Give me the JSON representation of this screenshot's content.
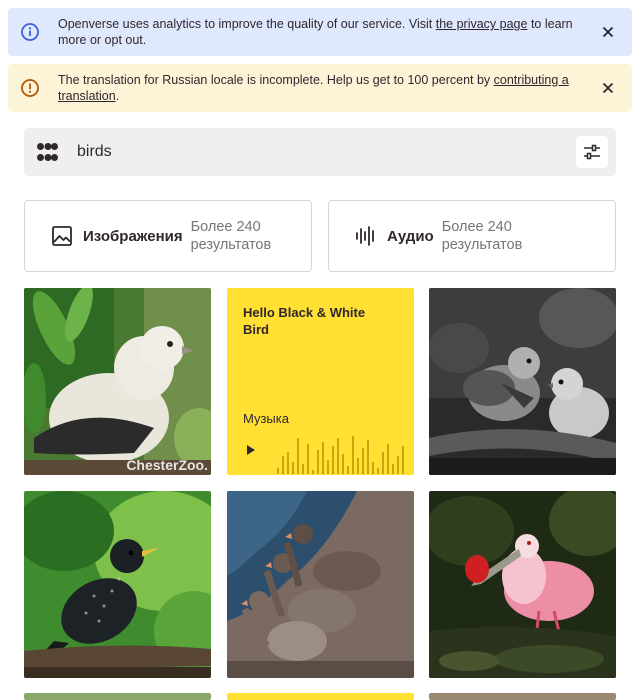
{
  "banners": {
    "analytics": {
      "text_before": "Openverse uses analytics to improve the quality of our service. Visit ",
      "link": "the privacy page",
      "text_after": " to learn more or opt out."
    },
    "translation": {
      "text_before": "The translation for Russian locale is incomplete. Help us get to 100 percent by ",
      "link": "contributing a translation",
      "text_after": "."
    }
  },
  "search": {
    "query": "birds"
  },
  "media_types": [
    {
      "label": "Изображения",
      "count": "Более 240 результатов"
    },
    {
      "label": "Аудио",
      "count": "Более 240 результатов"
    }
  ],
  "audio_results": [
    {
      "title": "Hello Black & White Bird",
      "genre": "Музыка"
    }
  ],
  "image_results": [
    {
      "name": "white-pigeon",
      "watermark": "ChesterZoo."
    },
    {
      "name": "sparrows-bw"
    },
    {
      "name": "starling"
    },
    {
      "name": "geese"
    },
    {
      "name": "spoonbill"
    }
  ],
  "colors": {
    "info_banner": "#dee9fd",
    "warning_banner": "#fdf4d8",
    "audio_tile": "#ffe033",
    "search_bg": "#efefef"
  }
}
